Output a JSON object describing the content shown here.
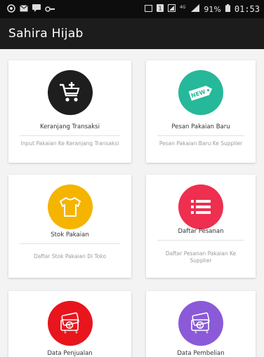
{
  "status_bar": {
    "left_icons": [
      "whatsapp-icon",
      "mail-icon",
      "message-icon",
      "key-icon"
    ],
    "right_icons": [
      "cast-icon",
      "sim-icon",
      "signal-icon",
      "lte-icon",
      "signal-bars-icon"
    ],
    "battery": "91%",
    "time": "01:53"
  },
  "app_bar": {
    "title": "Sahira Hijab"
  },
  "menu": [
    {
      "title": "Keranjang Transaksi",
      "description": "Input Pakaian Ke Keranjang Transaksi",
      "icon": "cart-add-icon",
      "color": "#1e1e1e"
    },
    {
      "title": "Pesan Pakaian Baru",
      "description": "Pesan Pakaian Baru Ke Supplier",
      "icon": "new-tag-icon",
      "color": "#26b89a"
    },
    {
      "title": "Stok Pakaian",
      "description": "Daftar Stok Pakaian Di Toko",
      "icon": "tshirt-icon",
      "color": "#f5b400"
    },
    {
      "title": "Daftar Pesanan",
      "description": "Daftar Pesanan Pakaian Ke Supplier",
      "icon": "list-icon",
      "color": "#ee2f4f"
    },
    {
      "title": "Data Penjualan",
      "description": "",
      "icon": "money-icon",
      "color": "#e8151d"
    },
    {
      "title": "Data Pembelian",
      "description": "",
      "icon": "money-icon",
      "color": "#8a5ad8"
    }
  ]
}
